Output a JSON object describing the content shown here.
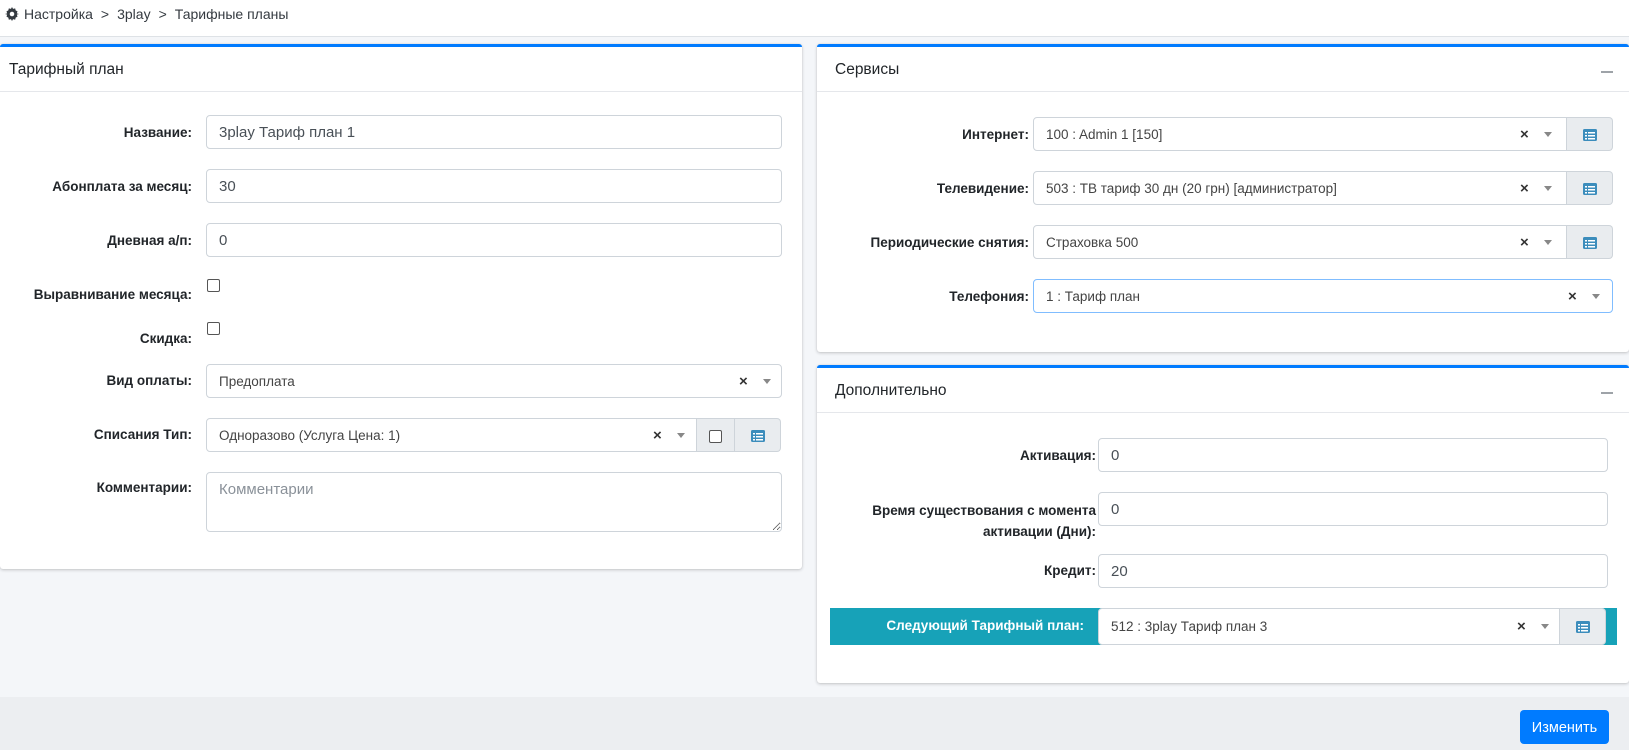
{
  "breadcrumb": [
    "Настройка",
    "3play",
    "Тарифные планы"
  ],
  "tariff_card": {
    "title": "Тарифный план",
    "fields": {
      "name_label": "Название:",
      "name_value": "3play Тариф план 1",
      "monthly_label": "Абонплата за месяц:",
      "monthly_value": "30",
      "daily_label": "Дневная а/п:",
      "daily_value": "0",
      "align_label": "Выравнивание месяца:",
      "discount_label": "Скидка:",
      "payment_label": "Вид оплаты:",
      "payment_value": "Предоплата",
      "charge_label": "Списания Тип:",
      "charge_value": "Одноразово (Услуга Цена: 1)",
      "comments_label": "Комментарии:",
      "comments_placeholder": "Комментарии"
    }
  },
  "services_card": {
    "title": "Сервисы",
    "rows": [
      {
        "label": "Интернет:",
        "value": "100 : Admin 1 [150]"
      },
      {
        "label": "Телевидение:",
        "value": "503 : ТВ тариф 30 дн (20 грн) [администратор]"
      },
      {
        "label": "Периодические снятия:",
        "value": "Страховка 500"
      },
      {
        "label": "Телефония:",
        "value": "1 : Тариф план"
      }
    ]
  },
  "extra_card": {
    "title": "Дополнительно",
    "activation_label": "Активация:",
    "activation_value": "0",
    "lifetime_label_1": "Время существования с момента",
    "lifetime_label_2": "активации (Дни):",
    "lifetime_value": "0",
    "credit_label": "Кредит:",
    "credit_value": "20",
    "next_plan_label": "Следующий Тарифный план:",
    "next_plan_value": "512 : 3play Тариф план 3"
  },
  "actions": {
    "submit_label": "Изменить"
  },
  "colors": {
    "accent": "#007bff",
    "highlight": "#17a2b8"
  }
}
